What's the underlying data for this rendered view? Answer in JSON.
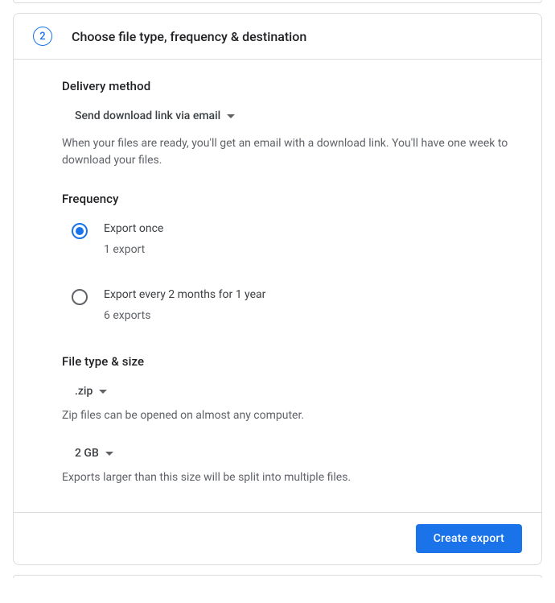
{
  "step": {
    "number": "2",
    "title": "Choose file type, frequency & destination"
  },
  "delivery": {
    "heading": "Delivery method",
    "selected": "Send download link via email",
    "help": "When your files are ready, you'll get an email with a download link. You'll have one week to download your files."
  },
  "frequency": {
    "heading": "Frequency",
    "options": [
      {
        "label": "Export once",
        "sublabel": "1 export",
        "selected": true
      },
      {
        "label": "Export every 2 months for 1 year",
        "sublabel": "6 exports",
        "selected": false
      }
    ]
  },
  "fileTypeSize": {
    "heading": "File type & size",
    "typeSelected": ".zip",
    "typeHelp": "Zip files can be opened on almost any computer.",
    "sizeSelected": "2 GB",
    "sizeHelp": "Exports larger than this size will be split into multiple files."
  },
  "footer": {
    "primaryButton": "Create export"
  }
}
